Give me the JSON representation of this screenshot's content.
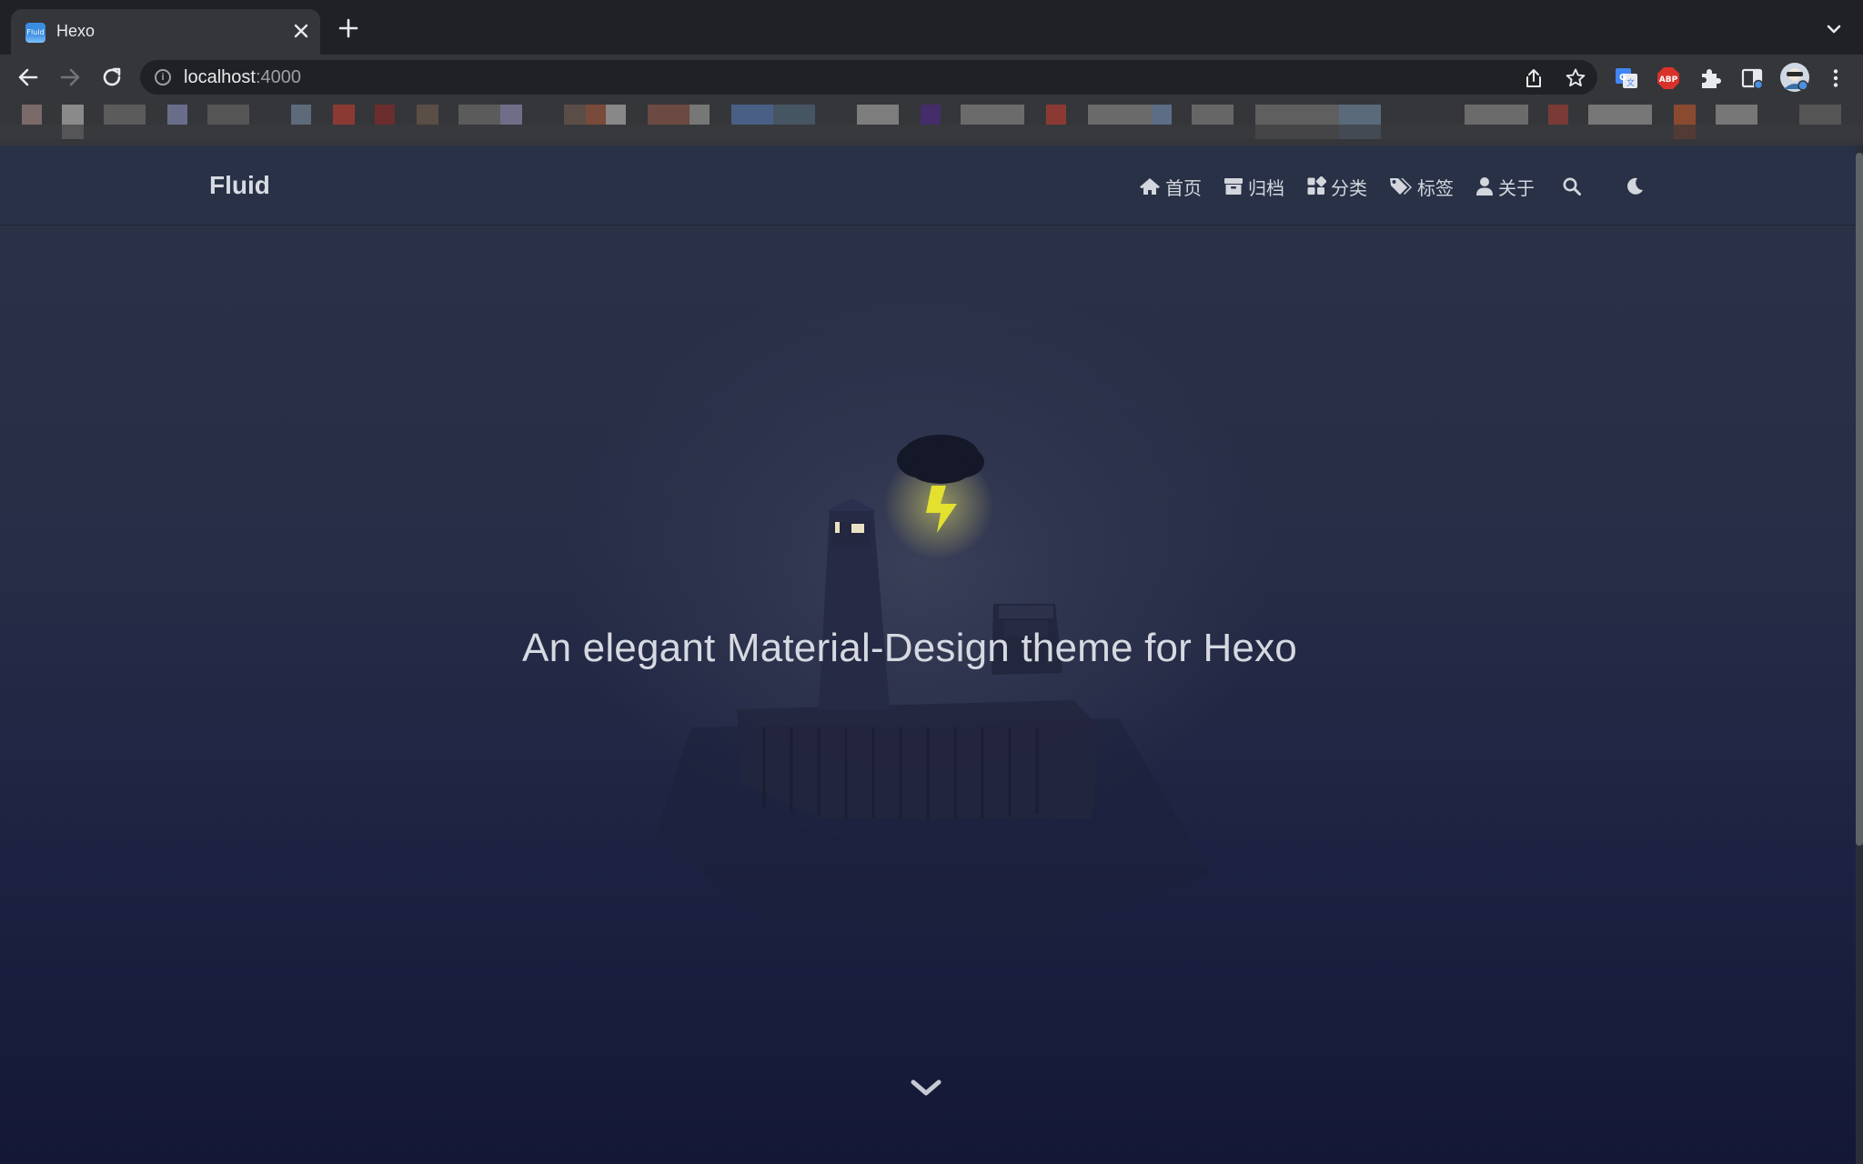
{
  "browser": {
    "tab": {
      "title": "Hexo",
      "favicon_text": "Fluid"
    },
    "address": {
      "host": "localhost",
      "port": ":4000"
    },
    "extensions": [
      "google-translate-icon",
      "adblock-plus-icon",
      "puzzle-extensions-icon",
      "side-panel-icon",
      "profile-avatar"
    ],
    "adblock_label": "ABP"
  },
  "site": {
    "brand": "Fluid",
    "nav": [
      {
        "label": "首页",
        "icon": "home-icon"
      },
      {
        "label": "归档",
        "icon": "archive-icon"
      },
      {
        "label": "分类",
        "icon": "category-icon"
      },
      {
        "label": "标签",
        "icon": "tags-icon"
      },
      {
        "label": "关于",
        "icon": "user-icon"
      }
    ],
    "slogan": "An elegant Material-Design theme for Hexo"
  },
  "colors": {
    "chrome_dark": "#202124",
    "chrome_toolbar": "#35363a",
    "navbar_text": "#d3d6dd",
    "lightning": "#e3e030",
    "banner_top": "#2b3247",
    "banner_bottom": "#141836"
  }
}
